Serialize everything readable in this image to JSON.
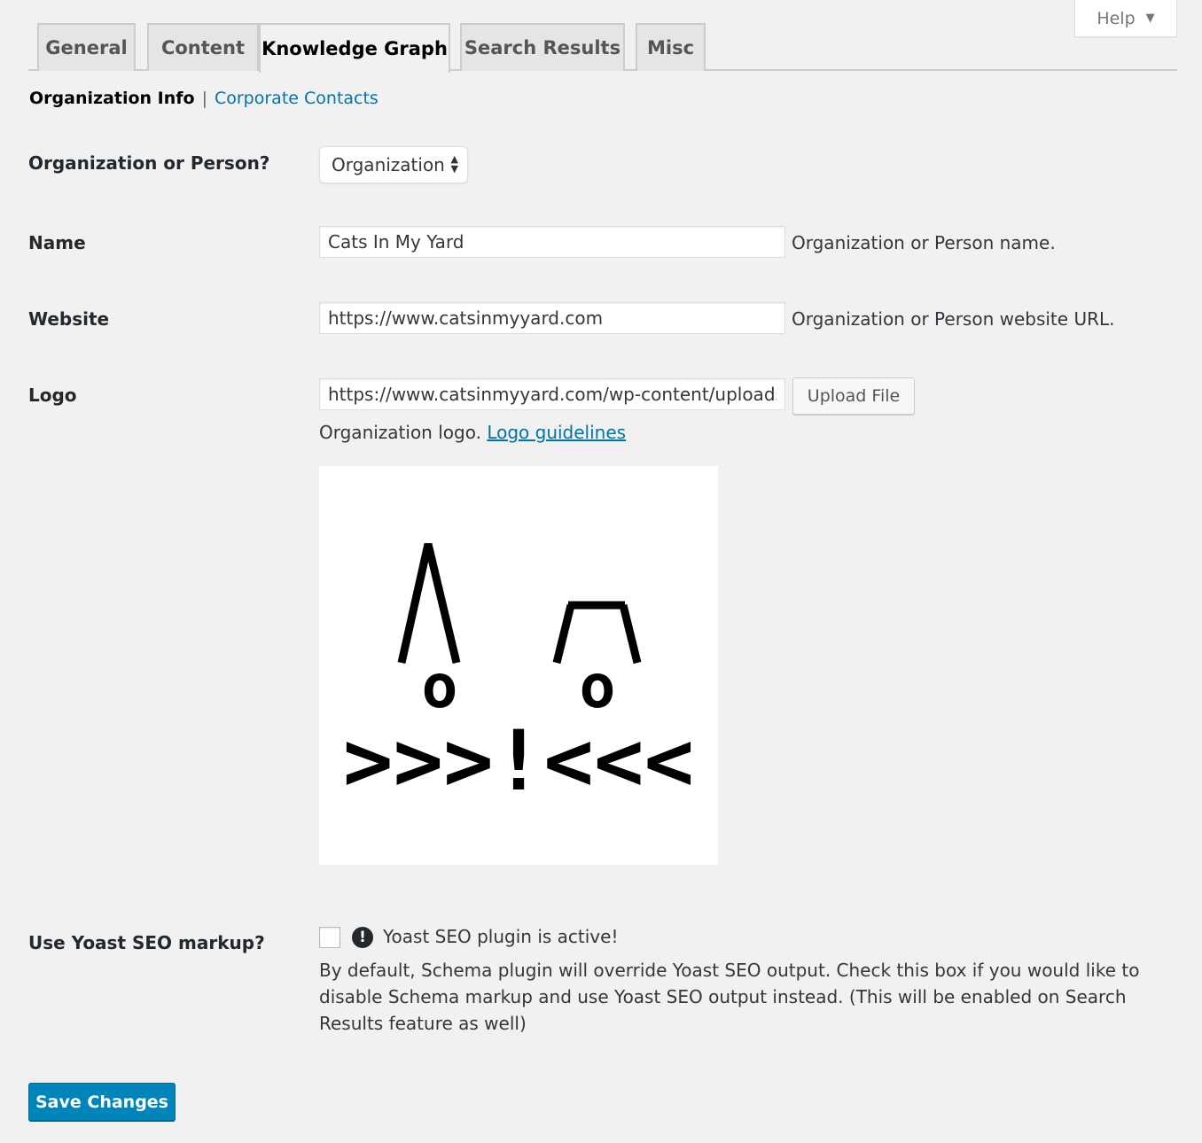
{
  "help": {
    "label": "Help"
  },
  "tabs": [
    {
      "label": "General"
    },
    {
      "label": "Content"
    },
    {
      "label": "Knowledge Graph",
      "active": true
    },
    {
      "label": "Search Results"
    },
    {
      "label": "Misc"
    }
  ],
  "subnav": {
    "current": "Organization Info",
    "separator": "|",
    "link": "Corporate Contacts"
  },
  "form": {
    "org_or_person": {
      "label": "Organization or Person?",
      "selected": "Organization"
    },
    "name": {
      "label": "Name",
      "value": "Cats In My Yard",
      "description": "Organization or Person name."
    },
    "website": {
      "label": "Website",
      "value": "https://www.catsinmyyard.com",
      "description": "Organization or Person website URL."
    },
    "logo": {
      "label": "Logo",
      "value": "https://www.catsinmyyard.com/wp-content/uploads/",
      "upload_label": "Upload File",
      "description": "Organization logo.",
      "guidelines_link": "Logo guidelines",
      "art": {
        "line1": "/\\  /‾\\",
        "line2": "o    o",
        "line3": ">>>!<<<"
      }
    },
    "yoast": {
      "label": "Use Yoast SEO markup?",
      "checked": false,
      "notice": "Yoast SEO plugin is active!",
      "description": "By default, Schema plugin will override Yoast SEO output. Check this box if you would like to disable Schema markup and use Yoast SEO output instead. (This will be enabled on Search Results feature as well)"
    }
  },
  "save": {
    "label": "Save Changes"
  },
  "colors": {
    "accent": "#0085ba",
    "link": "#0073aa",
    "background": "#f1f1f1"
  }
}
